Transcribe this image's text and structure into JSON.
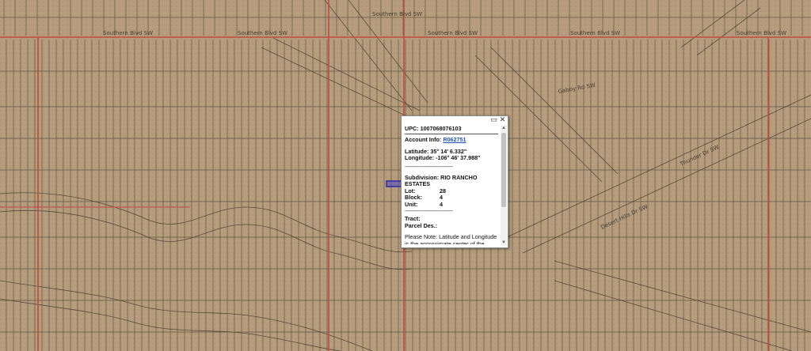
{
  "map": {
    "colors": {
      "ground": "#b49c7c",
      "parcel_line": "#4a3e30",
      "main_road": "#c24a40",
      "selected_parcel": "#2a2aa8"
    },
    "street_labels": [
      {
        "text": "Southern Blvd SW"
      },
      {
        "text": "Southern Blvd SW"
      },
      {
        "text": "Southern Blvd SW"
      },
      {
        "text": "Southern Blvd SW"
      },
      {
        "text": "Southern Blvd SW"
      },
      {
        "text": "Southern Blvd SW"
      },
      {
        "text": "Gabby Rd SW"
      },
      {
        "text": "Thunder Dr SW"
      },
      {
        "text": "Desert Hills Dr SW"
      }
    ]
  },
  "popup": {
    "upc": "UPC: 1007068076103",
    "account_label": "Account Info:",
    "account_value": "R062751",
    "latitude": "Latitude: 35° 14' 6.332\"",
    "longitude": "Longitude: -106° 46' 37.988\"",
    "divider": "--------------------------------",
    "subdivision": "Subdivision: RIO RANCHO ESTATES",
    "lot_label": "Lot:",
    "lot_value": "28",
    "block_label": "Block:",
    "block_value": "4",
    "unit_label": "Unit:",
    "unit_value": "4",
    "tract_label": "Tract:",
    "parcel_label": "Parcel Des.:",
    "note": "Please Note: Latitude and Longitude is the approximate center of the parcel shown.",
    "maximize_icon": "▭",
    "close_icon": "✕",
    "scroll_up_icon": "▲",
    "scroll_down_icon": "▼"
  }
}
